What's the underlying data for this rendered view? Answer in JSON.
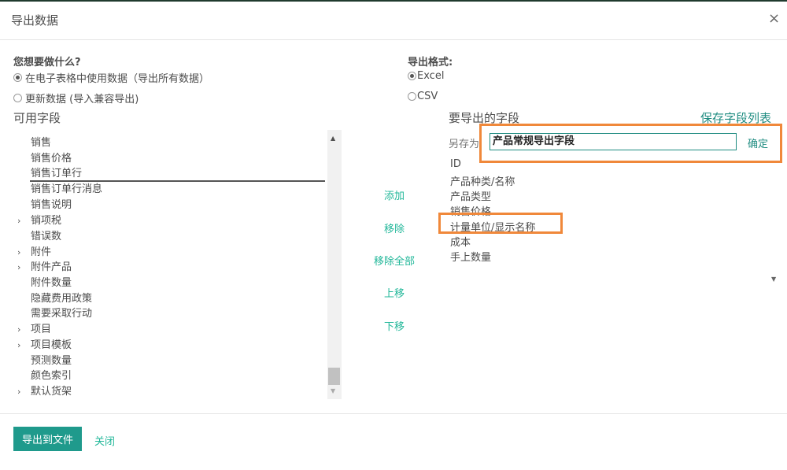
{
  "dialog": {
    "title": "导出数据",
    "close_glyph": "×"
  },
  "left_options": {
    "heading": "您想要做什么?",
    "options": [
      {
        "label": "在电子表格中使用数据（导出所有数据）",
        "selected": true
      },
      {
        "label": "更新数据 (导入兼容导出)",
        "selected": false
      }
    ]
  },
  "format_options": {
    "heading": "导出格式:",
    "options": [
      {
        "label": "Excel",
        "selected": true
      },
      {
        "label": "CSV",
        "selected": false
      }
    ]
  },
  "available_fields": {
    "title": "可用字段",
    "items": [
      {
        "label": "销售",
        "expandable": false
      },
      {
        "label": "销售价格",
        "expandable": false
      },
      {
        "label": "销售订单行",
        "expandable": false,
        "selected": true
      },
      {
        "label": "销售订单行消息",
        "expandable": false
      },
      {
        "label": "销售说明",
        "expandable": false
      },
      {
        "label": "销项税",
        "expandable": true
      },
      {
        "label": "错误数",
        "expandable": false
      },
      {
        "label": "附件",
        "expandable": true
      },
      {
        "label": "附件产品",
        "expandable": true
      },
      {
        "label": "附件数量",
        "expandable": false
      },
      {
        "label": "隐藏费用政策",
        "expandable": false
      },
      {
        "label": "需要采取行动",
        "expandable": false
      },
      {
        "label": "项目",
        "expandable": true
      },
      {
        "label": "项目模板",
        "expandable": true
      },
      {
        "label": "预测数量",
        "expandable": false
      },
      {
        "label": "颜色索引",
        "expandable": false
      },
      {
        "label": "默认货架",
        "expandable": true
      }
    ],
    "chevron_glyph": "›"
  },
  "actions": {
    "add": "添加",
    "remove": "移除",
    "remove_all": "移除全部",
    "move_up": "上移",
    "move_down": "下移"
  },
  "export_fields": {
    "title": "要导出的字段",
    "save_list": "保存字段列表",
    "save_as_label": "另存为",
    "save_as_value": "产品常规导出字段",
    "confirm": "确定",
    "fields": [
      "ID",
      "产品种类/名称",
      "产品类型",
      "销售价格",
      "计量单位/显示名称",
      "成本",
      "手上数量"
    ]
  },
  "footer": {
    "export_button": "导出到文件",
    "close_link": "关闭"
  },
  "colors": {
    "accent": "#1f9a8c",
    "link": "#21b799",
    "highlight": "#f0883a"
  }
}
